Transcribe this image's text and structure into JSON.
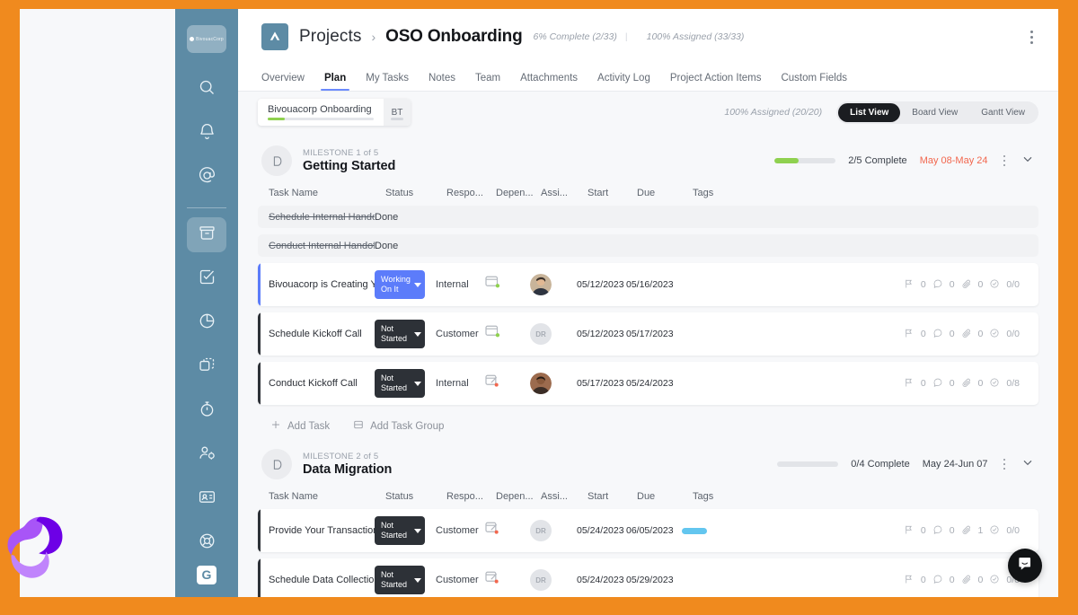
{
  "sidebar": {
    "logo_label": "BivouacCorp",
    "items": [
      {
        "name": "search",
        "icon": "search-icon"
      },
      {
        "name": "notifications",
        "icon": "bell-icon"
      },
      {
        "name": "mentions",
        "icon": "at-mention-icon"
      },
      {
        "name": "projects",
        "icon": "archive-box-icon",
        "active": true
      },
      {
        "name": "tasks",
        "icon": "checkbox-icon"
      },
      {
        "name": "reports",
        "icon": "pie-chart-icon"
      },
      {
        "name": "templates",
        "icon": "copy-layers-icon"
      },
      {
        "name": "time-tracking",
        "icon": "stopwatch-icon"
      },
      {
        "name": "team-settings",
        "icon": "user-gear-icon"
      },
      {
        "name": "contacts",
        "icon": "id-card-icon"
      }
    ],
    "bottom": [
      {
        "name": "help",
        "icon": "lifebuoy-icon"
      },
      {
        "name": "guide",
        "icon": "g-logo-icon",
        "label": "G"
      }
    ]
  },
  "header": {
    "app_icon": "rocketlane-logo-icon",
    "breadcrumb_root": "Projects",
    "breadcrumb_sep": "›",
    "project_title": "OSO Onboarding",
    "complete_meta": "6% Complete (2/33)",
    "assigned_meta": "100% Assigned (33/33)",
    "kebab": "more-options-icon"
  },
  "tabs": [
    {
      "label": "Overview",
      "active": false
    },
    {
      "label": "Plan",
      "active": true
    },
    {
      "label": "My Tasks",
      "active": false
    },
    {
      "label": "Notes",
      "active": false
    },
    {
      "label": "Team",
      "active": false
    },
    {
      "label": "Attachments",
      "active": false
    },
    {
      "label": "Activity Log",
      "active": false
    },
    {
      "label": "Project Action Items",
      "active": false
    },
    {
      "label": "Custom Fields",
      "active": false
    }
  ],
  "subbar": {
    "project_chip": {
      "name": "Bivouacorp Onboarding",
      "progress_pct": 16,
      "badge": "BT"
    },
    "assigned": "100% Assigned (20/20)",
    "views": [
      {
        "label": "List View",
        "active": true
      },
      {
        "label": "Board View",
        "active": false
      },
      {
        "label": "Gantt View",
        "active": false
      }
    ]
  },
  "columns": [
    "Task Name",
    "Status",
    "Respo...",
    "Depen...",
    "Assi...",
    "Start",
    "Due",
    "Tags"
  ],
  "milestones": [
    {
      "eyebrow": "MILESTONE 1 of 5",
      "title": "Getting Started",
      "progress_pct": 40,
      "count": "2/5 Complete",
      "dates": "May 08-May 24",
      "tasks": [
        {
          "name": "Schedule Internal Hando...",
          "done": true,
          "status_text": "Done"
        },
        {
          "name": "Conduct Internal Handoff...",
          "done": true,
          "status_text": "Done"
        },
        {
          "name": "Bivouacorp is Creating Y...",
          "done": false,
          "status": "Working On It",
          "status_color": "blue",
          "accent": "#5c7cfa",
          "responsible": "Internal",
          "dependency": "unblocked",
          "assignee": "photo-male-1",
          "start": "05/12/2023",
          "due": "05/16/2023",
          "tag": null,
          "counts": {
            "flag": "0",
            "comment": "0",
            "attachment": "0",
            "subtask": "0/0"
          }
        },
        {
          "name": "Schedule Kickoff Call",
          "done": false,
          "status": "Not Started",
          "status_color": "dark",
          "accent": "#2d3137",
          "responsible": "Customer",
          "dependency": "unblocked",
          "assignee": "DR",
          "start": "05/12/2023",
          "due": "05/17/2023",
          "tag": null,
          "counts": {
            "flag": "0",
            "comment": "0",
            "attachment": "0",
            "subtask": "0/0"
          }
        },
        {
          "name": "Conduct Kickoff Call",
          "done": false,
          "status": "Not Started",
          "status_color": "dark",
          "accent": "#2d3137",
          "responsible": "Internal",
          "dependency": "blocked",
          "assignee": "photo-male-2",
          "start": "05/17/2023",
          "due": "05/24/2023",
          "tag": null,
          "counts": {
            "flag": "0",
            "comment": "0",
            "attachment": "0",
            "subtask": "0/8"
          }
        }
      ],
      "add_task": "Add Task",
      "add_task_group": "Add Task Group"
    },
    {
      "eyebrow": "MILESTONE 2 of 5",
      "title": "Data Migration",
      "progress_pct": 0,
      "count": "0/4 Complete",
      "dates": "May 24-Jun 07",
      "tasks": [
        {
          "name": "Provide Your Transaction...",
          "done": false,
          "status": "Not Started",
          "status_color": "dark",
          "accent": "#2d3137",
          "responsible": "Customer",
          "dependency": "blocked",
          "assignee": "DR",
          "start": "05/24/2023",
          "due": "06/05/2023",
          "tag": "#63c6ef",
          "counts": {
            "flag": "0",
            "comment": "0",
            "attachment": "1",
            "subtask": "0/0"
          }
        },
        {
          "name": "Schedule Data Collectio...",
          "done": false,
          "status": "Not Started",
          "status_color": "dark",
          "accent": "#2d3137",
          "responsible": "Customer",
          "dependency": "blocked",
          "assignee": "DR",
          "start": "05/24/2023",
          "due": "05/29/2023",
          "tag": null,
          "counts": {
            "flag": "0",
            "comment": "0",
            "attachment": "0",
            "subtask": "0/0"
          }
        }
      ]
    }
  ],
  "widgets": {
    "intercom": "chat-bubble-icon"
  },
  "colors": {
    "frame": "#F08A1E",
    "sidebar": "#5d8ba5",
    "accent_blue": "#5c7cfa",
    "progress_green": "#8fd14f",
    "date_red": "#f2674e",
    "tag_blue": "#63c6ef"
  }
}
